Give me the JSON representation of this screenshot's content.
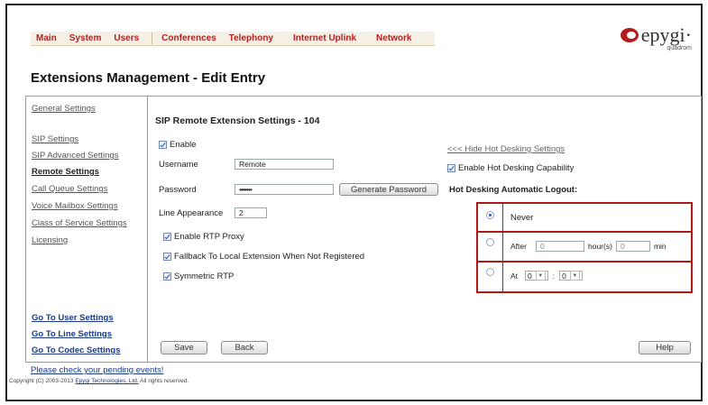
{
  "nav": [
    "Main",
    "System",
    "Users",
    "Conferences",
    "Telephony",
    "Internet Uplink",
    "Network"
  ],
  "logo": {
    "brand": "epygi",
    "sub": "quadrom"
  },
  "page_title": "Extensions Management - Edit Entry",
  "sidebar": {
    "items": [
      "General Settings",
      "SIP Settings",
      "SIP Advanced Settings",
      "Remote Settings",
      "Call Queue Settings",
      "Voice Mailbox Settings",
      "Class of Service Settings",
      "Licensing"
    ],
    "bottom_links": [
      "Go To User Settings",
      "Go To Line Settings",
      "Go To Codec Settings"
    ]
  },
  "content": {
    "title": "SIP Remote Extension Settings - 104",
    "enable_label": "Enable",
    "username_label": "Username",
    "username_value": "Remote",
    "password_label": "Password",
    "password_value": "•••••••",
    "generate_password": "Generate Password",
    "line_appearance_label": "Line Appearance",
    "line_appearance_value": "2",
    "enable_rtp_proxy": "Enable RTP Proxy",
    "fallback_local": "Fallback To Local Extension When Not Registered",
    "symmetric_rtp": "Symmetric RTP"
  },
  "hot_desking": {
    "hide_link": "<<< Hide Hot Desking Settings",
    "enable_label": "Enable Hot Desking Capability",
    "logout_title": "Hot Desking Automatic Logout:",
    "never": "Never",
    "after": "After",
    "hours_value": "0",
    "hours_label": "hour(s)",
    "min_value": "0",
    "min_label": "min",
    "at": "At",
    "at_hour": "0",
    "colon": ":",
    "at_min": "0"
  },
  "buttons": {
    "save": "Save",
    "back": "Back",
    "help": "Help"
  },
  "footer": {
    "pending": "Please check your pending events!",
    "copyright_prefix": "Copyright (C) 2003-2013",
    "company": "Epygi Technologies, Ltd.",
    "rights": "All rights reserved."
  },
  "colors": {
    "nav_text": "#b22222",
    "hot_desking_border": "#b01818",
    "link_blue": "#1a3a8a"
  }
}
